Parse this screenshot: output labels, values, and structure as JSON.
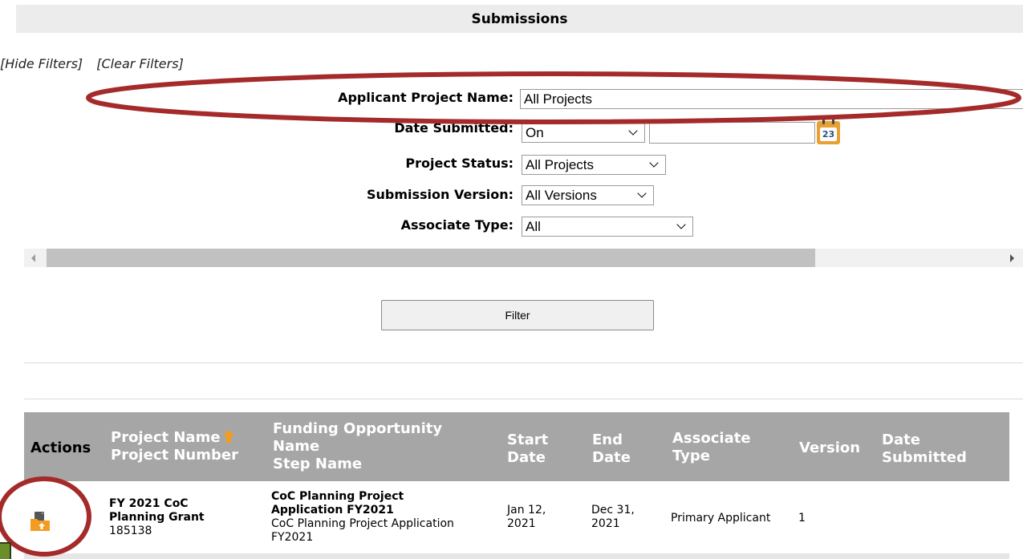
{
  "header": {
    "title": "Submissions"
  },
  "filter_links": {
    "hide": "[Hide Filters]",
    "clear": "[Clear Filters]"
  },
  "filters": {
    "project_name": {
      "label": "Applicant Project Name:",
      "value": "All Projects"
    },
    "date_submitted": {
      "label": "Date Submitted:",
      "operator": "On",
      "value": "",
      "calendar_day": "23"
    },
    "project_status": {
      "label": "Project Status:",
      "value": "All Projects"
    },
    "submission_version": {
      "label": "Submission Version:",
      "value": "All Versions"
    },
    "associate_type": {
      "label": "Associate Type:",
      "value": "All"
    }
  },
  "filter_button": "Filter",
  "table": {
    "headers": {
      "actions": "Actions",
      "project_name": "Project Name",
      "project_number": "Project Number",
      "funding_name_1": "Funding Opportunity",
      "funding_name_2": "Name",
      "step_name": "Step Name",
      "start_1": "Start",
      "start_2": "Date",
      "end_1": "End",
      "end_2": "Date",
      "assoc_1": "Associate",
      "assoc_2": "Type",
      "version": "Version",
      "submitted_1": "Date",
      "submitted_2": "Submitted"
    },
    "rows": [
      {
        "project_name_1": "FY 2021 CoC",
        "project_name_2": "Planning Grant",
        "project_number": "185138",
        "funding_1": "CoC Planning Project",
        "funding_2": "Application FY2021",
        "step_1": "CoC Planning Project Application",
        "step_2": "FY2021",
        "start_1": "Jan 12,",
        "start_2": "2021",
        "end_1": "Dec 31,",
        "end_2": "2021",
        "associate_type": "Primary Applicant",
        "version": "1",
        "date_submitted": ""
      }
    ]
  },
  "colors": {
    "header_bg": "#a6a6a6",
    "accent_orange": "#f39c1f",
    "annotation_red": "#a52a2a"
  }
}
